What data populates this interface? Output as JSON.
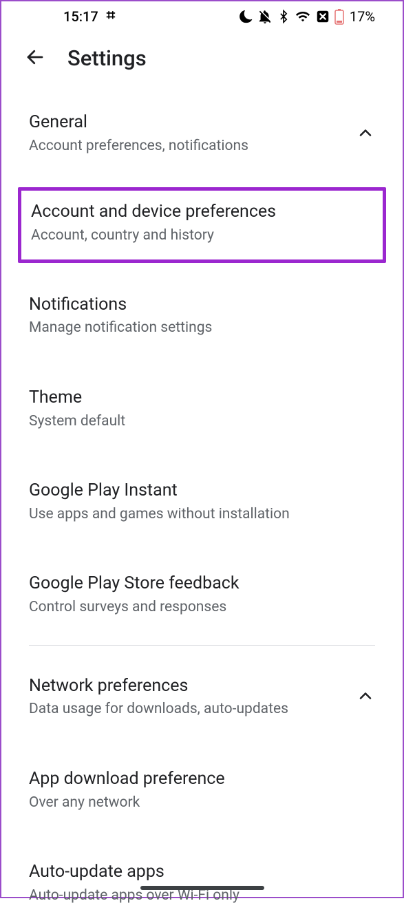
{
  "status": {
    "time": "15:17",
    "battery_pct": "17%"
  },
  "header": {
    "title": "Settings"
  },
  "sections": {
    "general": {
      "title": "General",
      "subtitle": "Account preferences, notifications"
    },
    "account_prefs": {
      "title": "Account and device preferences",
      "subtitle": "Account, country and history"
    },
    "notifications": {
      "title": "Notifications",
      "subtitle": "Manage notification settings"
    },
    "theme": {
      "title": "Theme",
      "subtitle": "System default"
    },
    "play_instant": {
      "title": "Google Play Instant",
      "subtitle": "Use apps and games without installation"
    },
    "feedback": {
      "title": "Google Play Store feedback",
      "subtitle": "Control surveys and responses"
    },
    "network": {
      "title": "Network preferences",
      "subtitle": "Data usage for downloads, auto-updates"
    },
    "download_pref": {
      "title": "App download preference",
      "subtitle": "Over any network"
    },
    "auto_update": {
      "title": "Auto-update apps",
      "subtitle": "Auto-update apps over Wi-Fi only"
    }
  }
}
